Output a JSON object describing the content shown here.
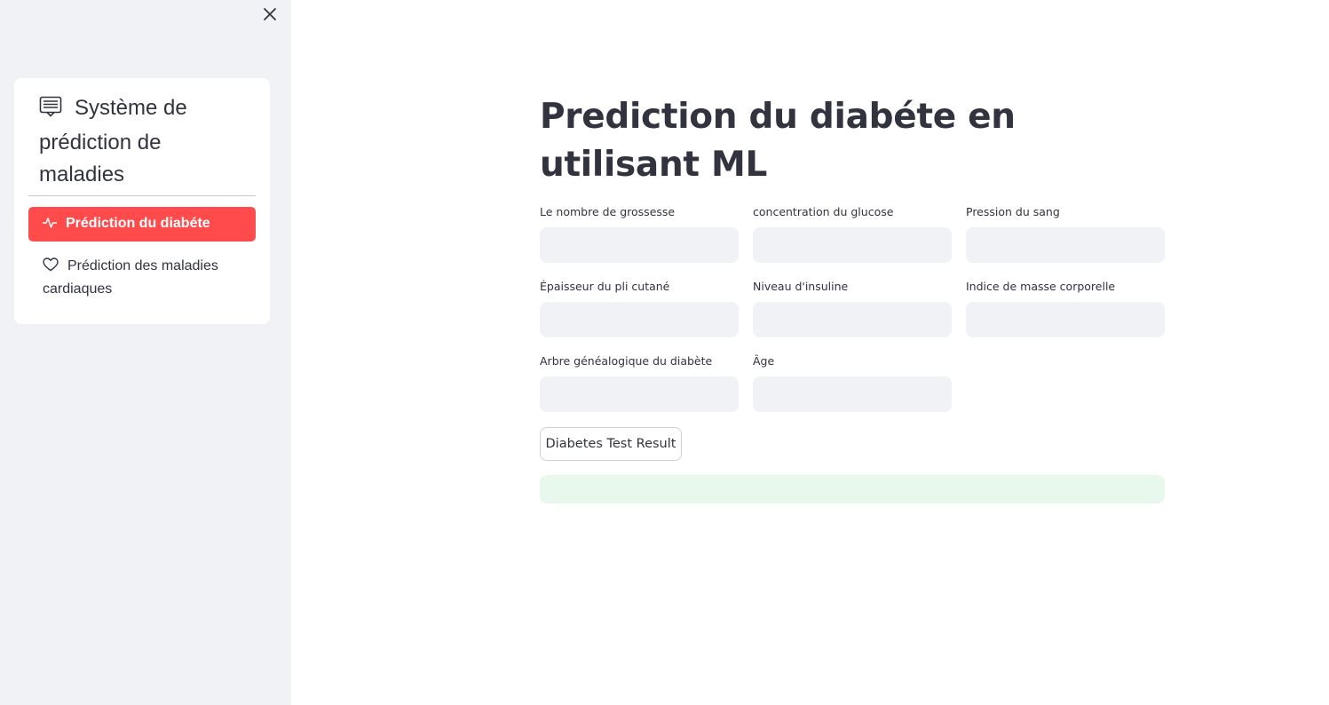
{
  "sidebar": {
    "menu_title": "Système de prédiction de maladies",
    "menu_title_icon": "document-lines-icon",
    "items": [
      {
        "label": "Prédiction du diabéte",
        "icon": "activity-pulse-icon",
        "active": true
      },
      {
        "label": "Prédiction des maladies cardiaques",
        "icon": "heart-icon",
        "active": false
      }
    ]
  },
  "main": {
    "title": "Prediction du diabéte en utilisant ML",
    "fields": [
      {
        "label": "Le nombre de grossesse",
        "value": ""
      },
      {
        "label": "concentration du glucose",
        "value": ""
      },
      {
        "label": "Pression du sang",
        "value": ""
      },
      {
        "label": "Épaisseur du pli cutané",
        "value": ""
      },
      {
        "label": "Niveau d'insuline",
        "value": ""
      },
      {
        "label": "Indice de masse corporelle",
        "value": ""
      },
      {
        "label": "Arbre généalogique du diabète",
        "value": ""
      },
      {
        "label": "Âge",
        "value": ""
      }
    ],
    "button_label": "Diabetes Test Result",
    "result_text": ""
  },
  "colors": {
    "accent": "#ff4b4b",
    "sidebar_bg": "#f0f2f6",
    "input_bg": "#f0f2f6",
    "success_bg": "#e8f8ec",
    "text": "#31333f"
  }
}
